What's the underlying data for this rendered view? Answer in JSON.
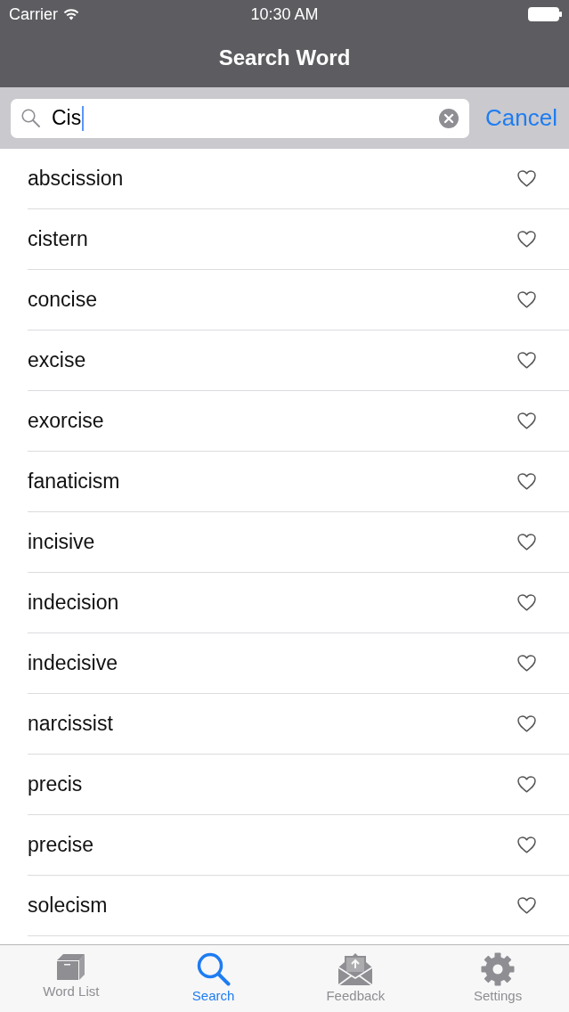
{
  "status_bar": {
    "carrier": "Carrier",
    "time": "10:30 AM"
  },
  "nav_bar": {
    "title": "Search Word"
  },
  "search": {
    "value": "Cis",
    "cancel": "Cancel"
  },
  "results": [
    {
      "word": "abscission",
      "favorite": false
    },
    {
      "word": "cistern",
      "favorite": false
    },
    {
      "word": "concise",
      "favorite": false
    },
    {
      "word": "excise",
      "favorite": false
    },
    {
      "word": "exorcise",
      "favorite": false
    },
    {
      "word": "fanaticism",
      "favorite": false
    },
    {
      "word": "incisive",
      "favorite": false
    },
    {
      "word": "indecision",
      "favorite": false
    },
    {
      "word": "indecisive",
      "favorite": false
    },
    {
      "word": "narcissist",
      "favorite": false
    },
    {
      "word": "precis",
      "favorite": false
    },
    {
      "word": "precise",
      "favorite": false
    },
    {
      "word": "solecism",
      "favorite": false
    }
  ],
  "tab_bar": [
    {
      "kind": "box",
      "label": "Word List",
      "selected": false
    },
    {
      "kind": "search",
      "label": "Search",
      "selected": true
    },
    {
      "kind": "mail",
      "label": "Feedback",
      "selected": false
    },
    {
      "kind": "gear",
      "label": "Settings",
      "selected": false
    }
  ]
}
